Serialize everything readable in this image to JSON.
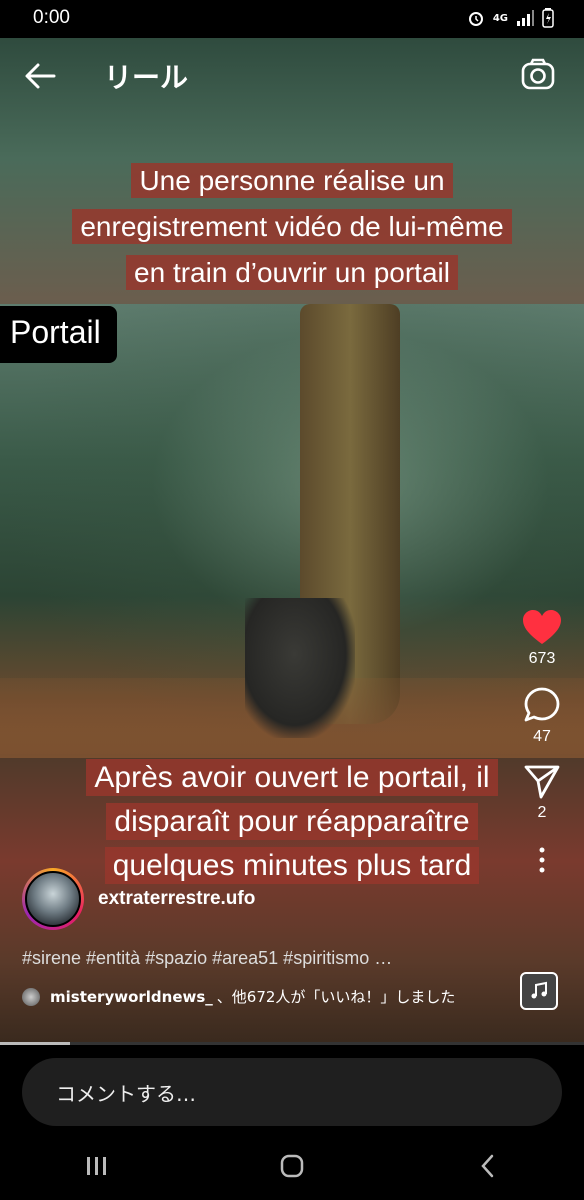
{
  "status_bar": {
    "time": "0:00",
    "network": "4G"
  },
  "header": {
    "title": "リール"
  },
  "video": {
    "caption_top": [
      "Une personne réalise un",
      "enregistrement vidéo de lui-même",
      "en train d’ouvrir un portail"
    ],
    "label": "Portail",
    "caption_bottom": [
      "Après avoir ouvert le portail, il",
      "disparaît pour réapparaître",
      "quelques minutes plus tard"
    ]
  },
  "actions": {
    "likes": "673",
    "comments": "47",
    "shares": "2"
  },
  "post": {
    "username": "extraterrestre.ufo",
    "hashtags": "#sirene #entità #spazio #area51 #spiritismo …",
    "liked_by_user": "misteryworldnews_",
    "liked_by_text": "、他672人が「いいね！」しました"
  },
  "progress": {
    "fraction": 0.12
  },
  "comment": {
    "placeholder": "コメントする…"
  },
  "icons": [
    "back-arrow-icon",
    "camera-icon",
    "heart-icon",
    "comment-icon",
    "send-icon",
    "more-icon",
    "music-icon",
    "recents-icon",
    "home-icon",
    "back-icon"
  ],
  "colors": {
    "heart": "#ff3040",
    "caption_bg": "#96372d"
  }
}
